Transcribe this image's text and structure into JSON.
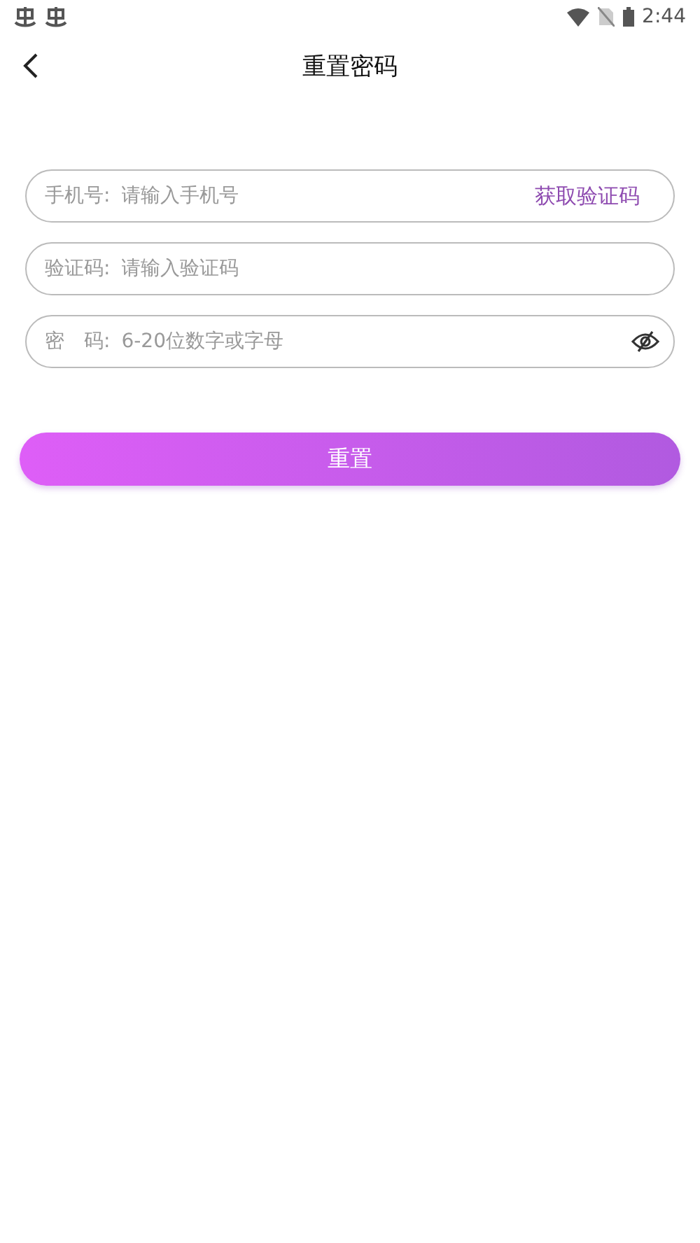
{
  "status_bar": {
    "time": "2:44"
  },
  "header": {
    "title": "重置密码"
  },
  "fields": [
    {
      "kind": "phone",
      "label": "手机号:",
      "placeholder": "请输入手机号",
      "action": "获取验证码"
    },
    {
      "kind": "code",
      "label": "验证码:",
      "placeholder": "请输入验证码"
    },
    {
      "kind": "password",
      "label": "密　码:",
      "placeholder": "6-20位数字或字母"
    }
  ],
  "submit_button": "重置"
}
